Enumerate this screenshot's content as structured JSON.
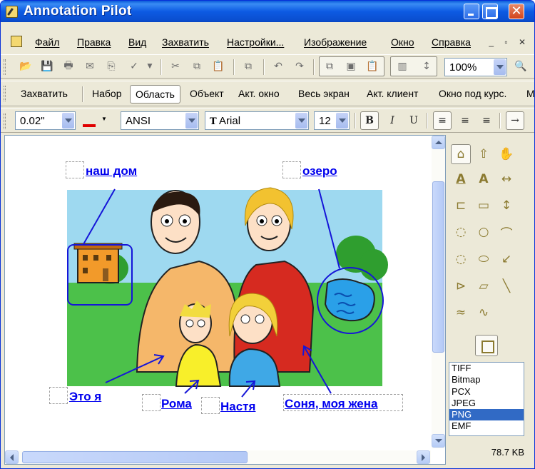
{
  "window": {
    "title": "Annotation Pilot"
  },
  "menu": [
    "Файл",
    "Правка",
    "Вид",
    "Захватить",
    "Настройки...",
    "Изображение",
    "Окно",
    "Справка"
  ],
  "toolbar": {
    "zoom": "100%"
  },
  "capture": [
    "Захватить",
    "Набор",
    "Область",
    "Объект",
    "Акт. окно",
    "Весь экран",
    "Акт. клиент",
    "Окно под курс.",
    "М"
  ],
  "capture_active": "Область",
  "format_bar": {
    "line_width": "0.02\"",
    "charset": "ANSI",
    "font": "Arial",
    "size": "12",
    "bold": "B",
    "italic": "I",
    "underline": "U"
  },
  "annotations": {
    "house": "наш дом",
    "lake": "озеро",
    "me": "Это я",
    "roma": "Рома",
    "nastya": "Настя",
    "sonya": "Соня, моя жена"
  },
  "formats": [
    "TIFF",
    "Bitmap",
    "PCX",
    "JPEG",
    "PNG",
    "EMF"
  ],
  "selected_format": "PNG",
  "file_size": "78.7 KB",
  "colors": {
    "annotation": "#0000ee",
    "pen": "#e00000",
    "selection": "#316ac5"
  }
}
